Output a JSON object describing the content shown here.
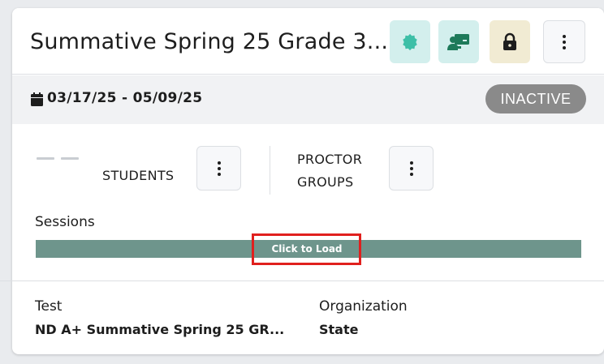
{
  "card": {
    "title": "Summative Spring 25 Grade 3...",
    "icons": [
      "verified-badge-icon",
      "classroom-icon",
      "lock-icon",
      "more-vertical-icon"
    ],
    "date_range": "03/17/25 - 05/09/25",
    "status": "INACTIVE"
  },
  "counts": {
    "students_value": "– –",
    "students_label": "STUDENTS",
    "proctor_line1": "PROCTOR",
    "proctor_line2": "GROUPS"
  },
  "sessions": {
    "label": "Sessions",
    "load_label": "Click to Load"
  },
  "details": {
    "test_label": "Test",
    "test_value": "ND A+ Summative Spring 25 GR...",
    "org_label": "Organization",
    "org_value": "State"
  },
  "colors": {
    "teal_bg": "#d3efed",
    "lock_bg": "#f1ebd3",
    "status_badge": "#8a8a8a",
    "session_bar": "#6e958c",
    "highlight": "#e0201e"
  }
}
